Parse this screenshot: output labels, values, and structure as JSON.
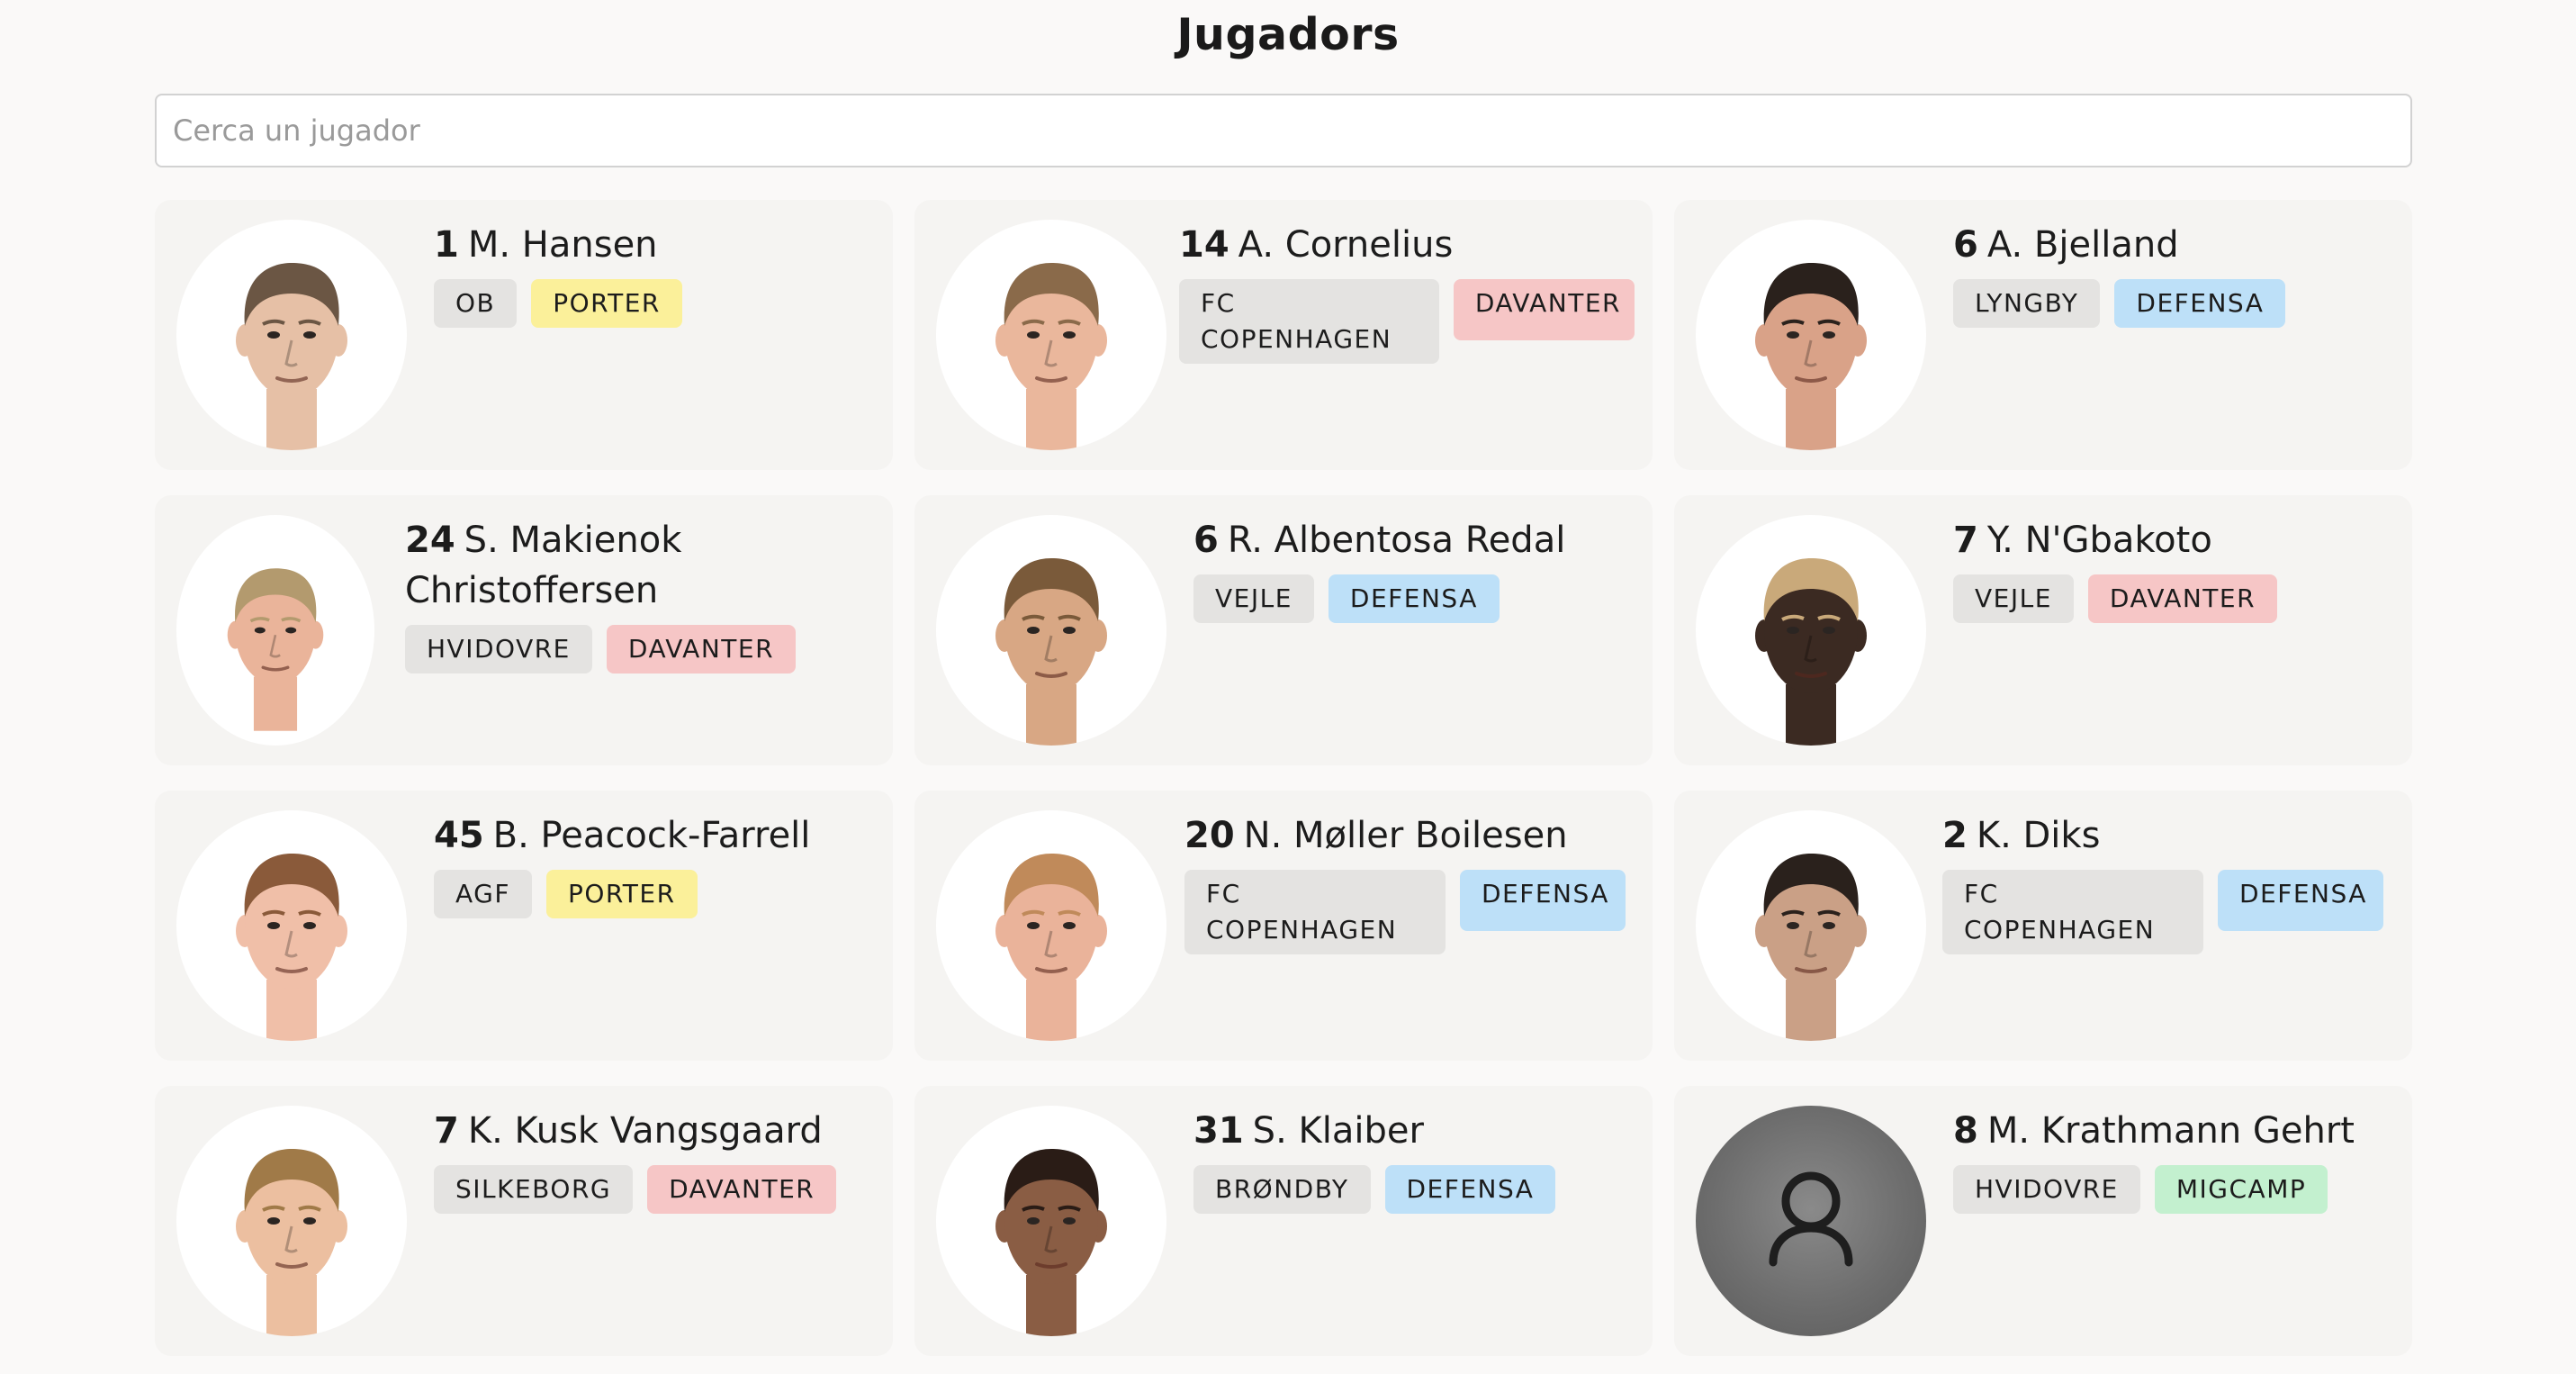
{
  "page_title": "Jugadors",
  "search": {
    "placeholder": "Cerca un jugador",
    "value": ""
  },
  "colors": {
    "porter": "#fbf09a",
    "davanter": "#f6c6c6",
    "defensa": "#bde0f8",
    "migcamp": "#c3f0cf",
    "team": "#e4e3e1"
  },
  "players": [
    {
      "number": "1",
      "name": "M. Hansen",
      "team": "OB",
      "position": "PORTER",
      "photo": true,
      "skin": "#e6c0a6",
      "hair": "#6b5644"
    },
    {
      "number": "14",
      "name": "A. Cornelius",
      "team": "FC COPENHAGEN",
      "position": "DAVANTER",
      "photo": true,
      "skin": "#eab79c",
      "hair": "#8a6a4a"
    },
    {
      "number": "6",
      "name": "A. Bjelland",
      "team": "LYNGBY",
      "position": "DEFENSA",
      "photo": true,
      "skin": "#d9a288",
      "hair": "#2a211c"
    },
    {
      "number": "24",
      "name": "S. Makienok Christoffersen",
      "team": "HVIDOVRE",
      "position": "DAVANTER",
      "photo": true,
      "skin": "#eab49a",
      "hair": "#b39a6e"
    },
    {
      "number": "6",
      "name": "R. Albentosa Redal",
      "team": "VEJLE",
      "position": "DEFENSA",
      "photo": true,
      "skin": "#d8a784",
      "hair": "#7a5a3a"
    },
    {
      "number": "7",
      "name": "Y. N'Gbakoto",
      "team": "VEJLE",
      "position": "DAVANTER",
      "photo": true,
      "skin": "#3b2a22",
      "hair": "#c9a97a"
    },
    {
      "number": "45",
      "name": "B. Peacock-Farrell",
      "team": "AGF",
      "position": "PORTER",
      "photo": true,
      "skin": "#f0bfa8",
      "hair": "#8a5a3a"
    },
    {
      "number": "20",
      "name": "N. Møller Boilesen",
      "team": "FC COPENHAGEN",
      "position": "DEFENSA",
      "photo": true,
      "skin": "#eab39a",
      "hair": "#c08a5a"
    },
    {
      "number": "2",
      "name": "K. Diks",
      "team": "FC COPENHAGEN",
      "position": "DEFENSA",
      "photo": true,
      "skin": "#caa086",
      "hair": "#2a211c"
    },
    {
      "number": "7",
      "name": "K. Kusk Vangsgaard",
      "team": "SILKEBORG",
      "position": "DAVANTER",
      "photo": true,
      "skin": "#ecbfa0",
      "hair": "#a07a48"
    },
    {
      "number": "31",
      "name": "S. Klaiber",
      "team": "BRØNDBY",
      "position": "DEFENSA",
      "photo": true,
      "skin": "#8a5d44",
      "hair": "#2a1c16"
    },
    {
      "number": "8",
      "name": "M. Krathmann Gehrt",
      "team": "HVIDOVRE",
      "position": "MIGCAMP",
      "photo": false,
      "skin": "",
      "hair": ""
    }
  ]
}
